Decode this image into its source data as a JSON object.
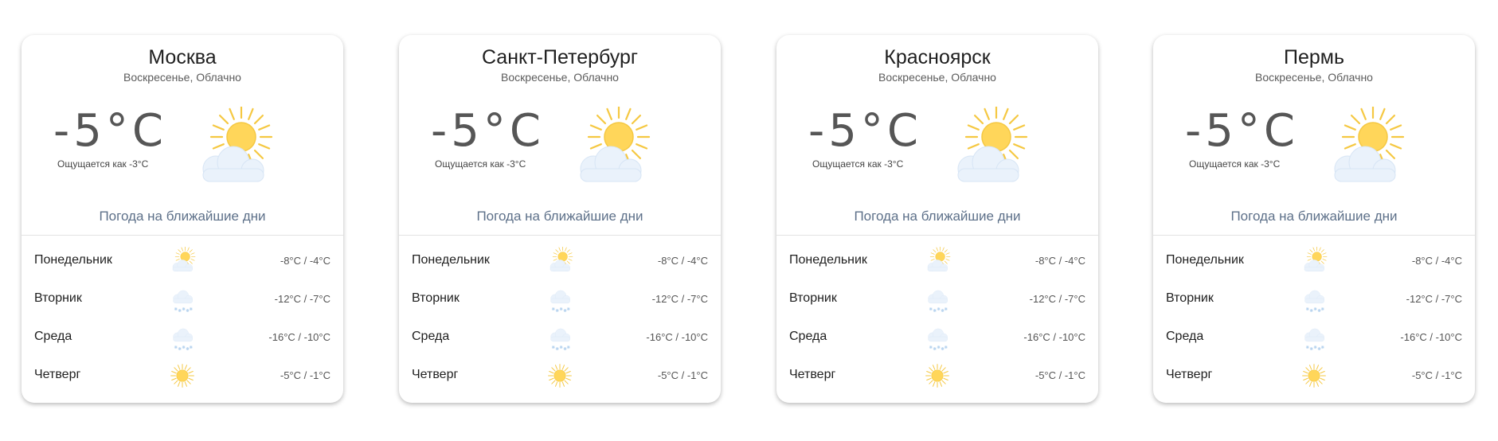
{
  "colors": {
    "sun": "#ffd65a",
    "sun_stroke": "#f5c842",
    "cloud": "#eaf2fb",
    "snow": "#b8d4ef",
    "accent_text": "#5d7089"
  },
  "cards": [
    {
      "city": "Москва",
      "condition": "Воскресенье, Облачно",
      "temperature": "-5°C",
      "feels_like": "Ощущается как -3°C",
      "icon": "sun-cloud-icon",
      "forecast_title": "Погода на ближайшие дни",
      "forecast": [
        {
          "day": "Понедельник",
          "icon": "sun-cloud-icon",
          "range": "-8°C / -4°C"
        },
        {
          "day": "Вторник",
          "icon": "snow-icon",
          "range": "-12°C / -7°C"
        },
        {
          "day": "Среда",
          "icon": "snow-icon",
          "range": "-16°C / -10°C"
        },
        {
          "day": "Четверг",
          "icon": "sun-icon",
          "range": "-5°C / -1°C"
        }
      ]
    },
    {
      "city": "Санкт-Петербург",
      "condition": "Воскресенье, Облачно",
      "temperature": "-5°C",
      "feels_like": "Ощущается как -3°C",
      "icon": "sun-cloud-icon",
      "forecast_title": "Погода на ближайшие дни",
      "forecast": [
        {
          "day": "Понедельник",
          "icon": "sun-cloud-icon",
          "range": "-8°C / -4°C"
        },
        {
          "day": "Вторник",
          "icon": "snow-icon",
          "range": "-12°C / -7°C"
        },
        {
          "day": "Среда",
          "icon": "snow-icon",
          "range": "-16°C / -10°C"
        },
        {
          "day": "Четверг",
          "icon": "sun-icon",
          "range": "-5°C / -1°C"
        }
      ]
    },
    {
      "city": "Красноярск",
      "condition": "Воскресенье, Облачно",
      "temperature": "-5°C",
      "feels_like": "Ощущается как -3°C",
      "icon": "sun-cloud-icon",
      "forecast_title": "Погода на ближайшие дни",
      "forecast": [
        {
          "day": "Понедельник",
          "icon": "sun-cloud-icon",
          "range": "-8°C / -4°C"
        },
        {
          "day": "Вторник",
          "icon": "snow-icon",
          "range": "-12°C / -7°C"
        },
        {
          "day": "Среда",
          "icon": "snow-icon",
          "range": "-16°C / -10°C"
        },
        {
          "day": "Четверг",
          "icon": "sun-icon",
          "range": "-5°C / -1°C"
        }
      ]
    },
    {
      "city": "Пермь",
      "condition": "Воскресенье, Облачно",
      "temperature": "-5°C",
      "feels_like": "Ощущается как -3°C",
      "icon": "sun-cloud-icon",
      "forecast_title": "Погода на ближайшие дни",
      "forecast": [
        {
          "day": "Понедельник",
          "icon": "sun-cloud-icon",
          "range": "-8°C / -4°C"
        },
        {
          "day": "Вторник",
          "icon": "snow-icon",
          "range": "-12°C / -7°C"
        },
        {
          "day": "Среда",
          "icon": "snow-icon",
          "range": "-16°C / -10°C"
        },
        {
          "day": "Четверг",
          "icon": "sun-icon",
          "range": "-5°C / -1°C"
        }
      ]
    }
  ]
}
